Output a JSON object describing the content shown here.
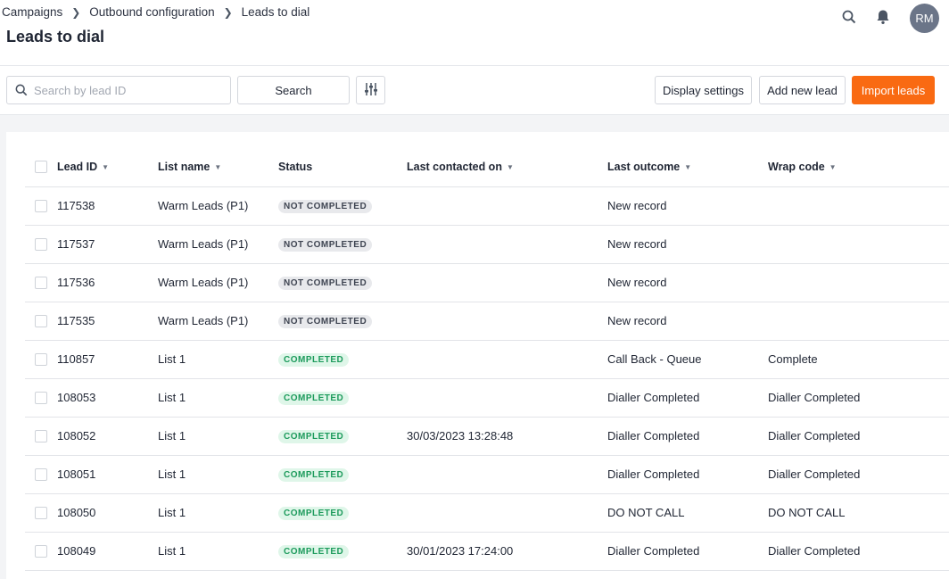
{
  "breadcrumb": [
    {
      "label": "Campaigns"
    },
    {
      "label": "Outbound configuration"
    },
    {
      "label": "Leads to dial"
    }
  ],
  "page_title": "Leads to dial",
  "user": {
    "initials": "RM"
  },
  "icons": {
    "search": "search-icon",
    "notifications": "bell-icon",
    "filter": "sliders-icon",
    "checkbox": "checkbox"
  },
  "toolbar": {
    "search_placeholder": "Search by lead ID",
    "search_value": "",
    "search_button": "Search",
    "display_settings": "Display settings",
    "add_new_lead": "Add new lead",
    "import_leads": "Import leads"
  },
  "colors": {
    "accent": "#f96a12",
    "completed": "#1d9b5c",
    "not_completed_bg": "#e8e9ec"
  },
  "table": {
    "columns": [
      "Lead ID",
      "List name",
      "Status",
      "Last contacted on",
      "Last outcome",
      "Wrap code"
    ],
    "rows": [
      {
        "id": "117538",
        "list": "Warm Leads (P1)",
        "status": "NOT COMPLETED",
        "last": "",
        "outcome": "New record",
        "wrap": ""
      },
      {
        "id": "117537",
        "list": "Warm Leads (P1)",
        "status": "NOT COMPLETED",
        "last": "",
        "outcome": "New record",
        "wrap": ""
      },
      {
        "id": "117536",
        "list": "Warm Leads (P1)",
        "status": "NOT COMPLETED",
        "last": "",
        "outcome": "New record",
        "wrap": ""
      },
      {
        "id": "117535",
        "list": "Warm Leads (P1)",
        "status": "NOT COMPLETED",
        "last": "",
        "outcome": "New record",
        "wrap": ""
      },
      {
        "id": "110857",
        "list": "List 1",
        "status": "COMPLETED",
        "last": "",
        "outcome": "Call Back - Queue",
        "wrap": "Complete"
      },
      {
        "id": "108053",
        "list": "List 1",
        "status": "COMPLETED",
        "last": "",
        "outcome": "Dialler Completed",
        "wrap": "Dialler Completed"
      },
      {
        "id": "108052",
        "list": "List 1",
        "status": "COMPLETED",
        "last": "30/03/2023 13:28:48",
        "outcome": "Dialler Completed",
        "wrap": "Dialler Completed"
      },
      {
        "id": "108051",
        "list": "List 1",
        "status": "COMPLETED",
        "last": "",
        "outcome": "Dialler Completed",
        "wrap": "Dialler Completed"
      },
      {
        "id": "108050",
        "list": "List 1",
        "status": "COMPLETED",
        "last": "",
        "outcome": "DO NOT CALL",
        "wrap": "DO NOT CALL"
      },
      {
        "id": "108049",
        "list": "List 1",
        "status": "COMPLETED",
        "last": "30/01/2023 17:24:00",
        "outcome": "Dialler Completed",
        "wrap": "Dialler Completed"
      }
    ]
  }
}
